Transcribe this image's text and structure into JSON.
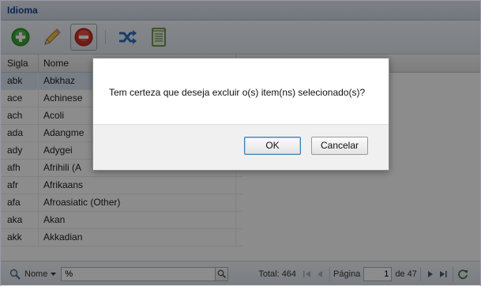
{
  "window": {
    "title": "Idioma"
  },
  "toolbar": {
    "buttons": [
      {
        "icon": "add-icon"
      },
      {
        "icon": "edit-icon"
      },
      {
        "icon": "delete-icon"
      },
      {
        "icon": "shuffle-icon"
      },
      {
        "icon": "notebook-icon"
      }
    ]
  },
  "grid": {
    "columns": [
      "Sigla",
      "Nome"
    ],
    "rows": [
      {
        "sigla": "abk",
        "nome": "Abkhaz"
      },
      {
        "sigla": "ace",
        "nome": "Achinese"
      },
      {
        "sigla": "ach",
        "nome": "Acoli"
      },
      {
        "sigla": "ada",
        "nome": "Adangme"
      },
      {
        "sigla": "ady",
        "nome": "Adygei"
      },
      {
        "sigla": "afh",
        "nome": "Afrihili (A"
      },
      {
        "sigla": "afr",
        "nome": "Afrikaans"
      },
      {
        "sigla": "afa",
        "nome": "Afroasiatic (Other)"
      },
      {
        "sigla": "aka",
        "nome": "Akan"
      },
      {
        "sigla": "akk",
        "nome": "Akkadian"
      }
    ]
  },
  "paging": {
    "field_label": "Nome",
    "search_value": "%",
    "total_label": "Total: 464",
    "page_label": "Página",
    "page_value": "1",
    "of_label": "de 47"
  },
  "dialog": {
    "message": "Tem certeza que deseja excluir o(s) item(ns) selecionado(s)?",
    "ok_label": "OK",
    "cancel_label": "Cancelar"
  },
  "colors": {
    "title_text": "#15428b",
    "selected_row": "#d9e5f4",
    "overlay": "rgba(0,0,0,0.45)"
  }
}
